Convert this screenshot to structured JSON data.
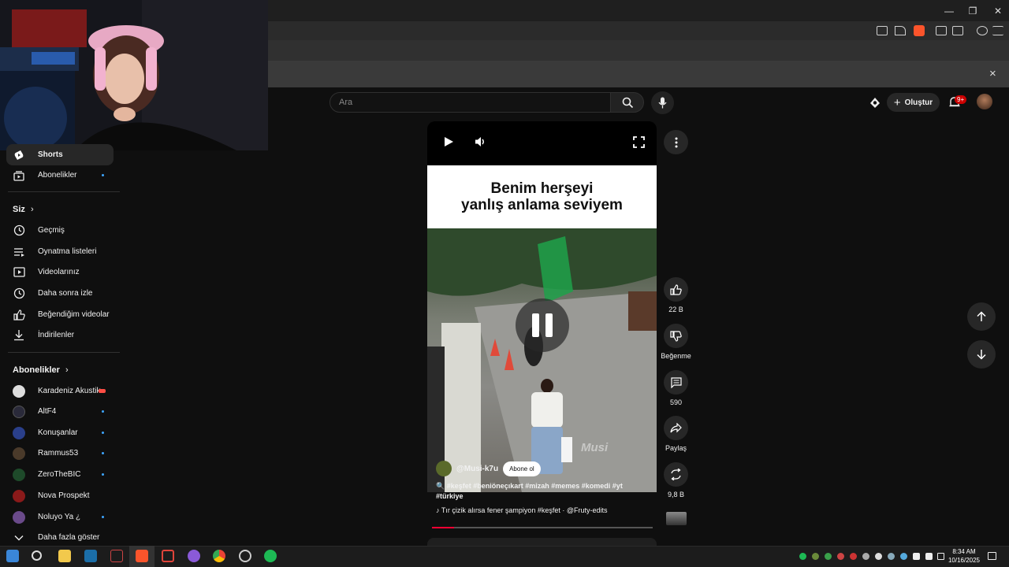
{
  "browser": {
    "close_infobar": "×",
    "window_controls": {
      "minimize": "—",
      "restore": "❐",
      "close": "✕"
    }
  },
  "header": {
    "search_placeholder": "Ara",
    "create_label": "Oluştur",
    "notifications_badge": "9+"
  },
  "sidebar": {
    "top_items": [
      {
        "label": "Shorts",
        "icon": "shorts-icon"
      },
      {
        "label": "Abonelikler",
        "icon": "subscriptions-icon"
      }
    ],
    "you_section": "Siz",
    "you_items": [
      {
        "label": "Geçmiş",
        "icon": "history-icon"
      },
      {
        "label": "Oynatma listeleri",
        "icon": "playlists-icon"
      },
      {
        "label": "Videolarınız",
        "icon": "your-videos-icon"
      },
      {
        "label": "Daha sonra izle",
        "icon": "watch-later-icon"
      },
      {
        "label": "Beğendiğim videolar",
        "icon": "liked-icon"
      },
      {
        "label": "İndirilenler",
        "icon": "downloads-icon"
      }
    ],
    "subs_section": "Abonelikler",
    "subscriptions": [
      {
        "label": "Karadeniz Akustik",
        "avatar_color": "#dddddd",
        "live": true
      },
      {
        "label": "AltF4",
        "avatar_color": "#2a2a3a"
      },
      {
        "label": "Konuşanlar",
        "avatar_color": "#2a3f8a"
      },
      {
        "label": "Rammus53",
        "avatar_color": "#4a3a2a"
      },
      {
        "label": "ZeroTheBIC",
        "avatar_color": "#1e4a2a"
      },
      {
        "label": "Nova Prospekt",
        "avatar_color": "#8a1a1a",
        "no_dot": true
      },
      {
        "label": "Noluyo Ya ¿",
        "avatar_color": "#6a4a8a"
      }
    ],
    "show_more": "Daha fazla göster"
  },
  "short": {
    "caption": [
      "Benim herşeyi",
      "yanlış anlama seviyem"
    ],
    "watermark": "Musi",
    "channel_handle": "@Musi-k7u",
    "subscribe_label": "Abone ol",
    "tags": "🔍 #keşfet #beniöneçıkart #mizah #memes #komedi #yt #türkiye",
    "music": "Tır çizik alırsa fener şampiyon #keşfet · @Fruty-edits",
    "progress": 0.1
  },
  "actions": {
    "like_count": "22 B",
    "dislike_label": "Beğenme",
    "comment_count": "590",
    "share_label": "Paylaş",
    "remix_count": "9,8 B"
  },
  "taskbar": {
    "time": "8:34 AM",
    "date": "10/16/2025"
  },
  "colors": {
    "accent": "#ff0033",
    "live": "#ff4e45",
    "subscribed_dot": "#3ea6ff"
  }
}
